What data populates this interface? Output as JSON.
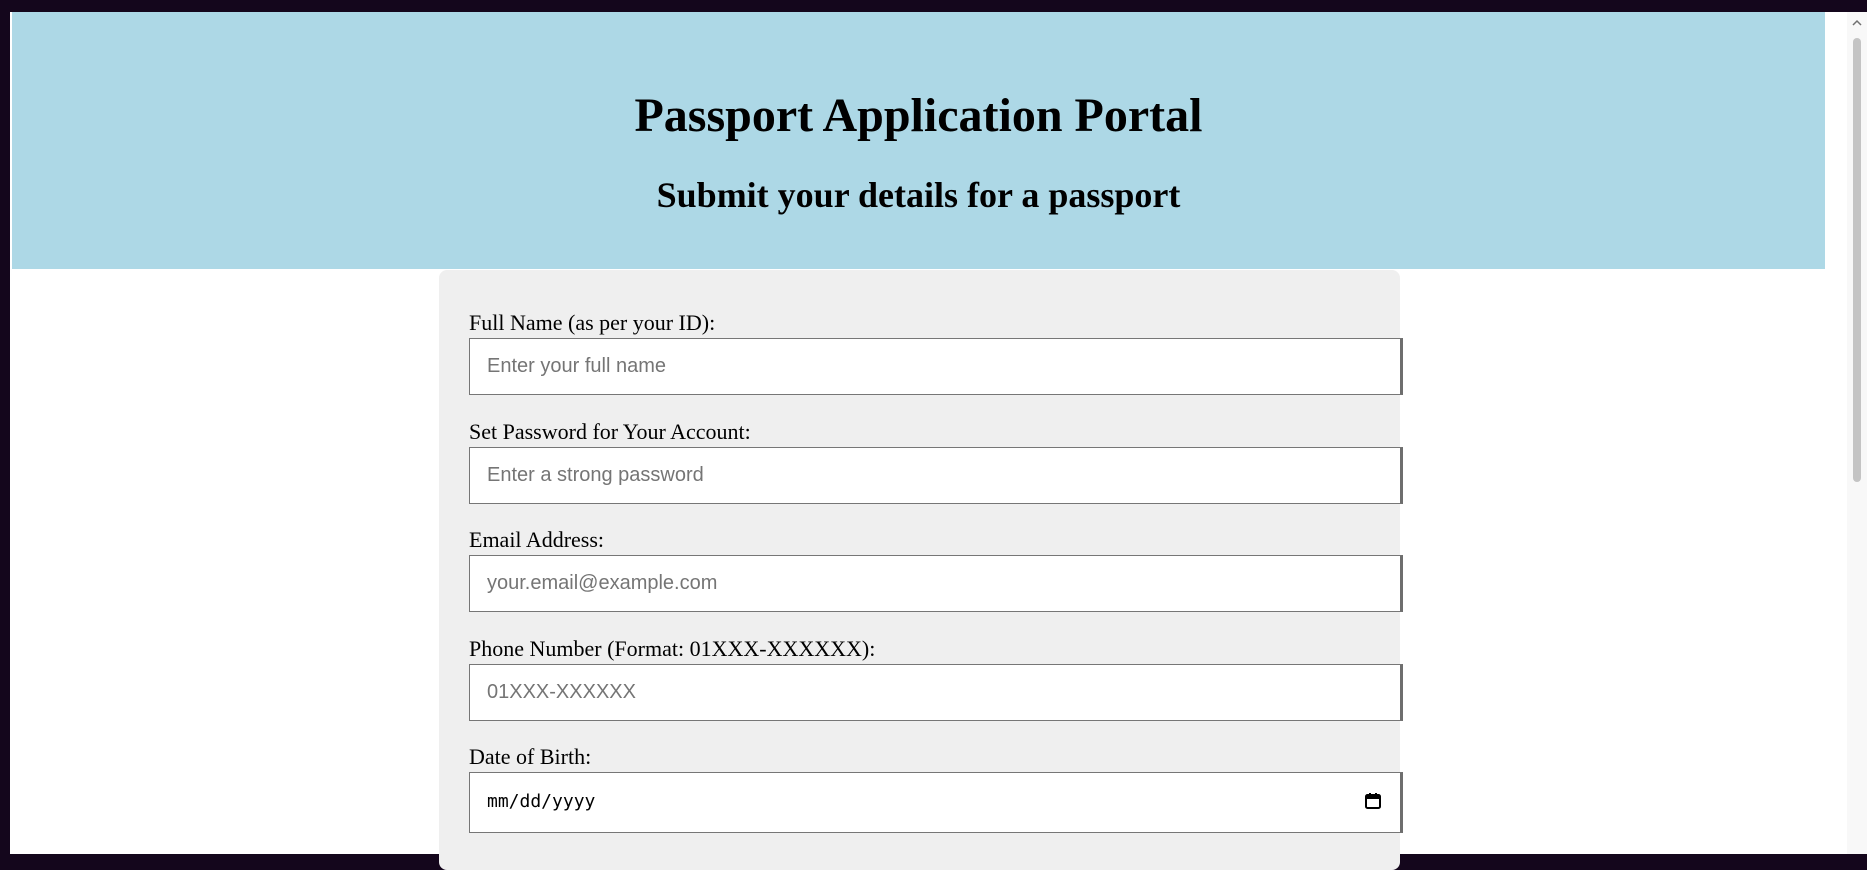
{
  "header": {
    "title": "Passport Application Portal",
    "subtitle": "Submit your details for a passport"
  },
  "form": {
    "full_name": {
      "label": "Full Name (as per your ID):",
      "placeholder": "Enter your full name"
    },
    "password": {
      "label": "Set Password for Your Account:",
      "placeholder": "Enter a strong password"
    },
    "email": {
      "label": "Email Address:",
      "placeholder": "your.email@example.com"
    },
    "phone": {
      "label": "Phone Number (Format: 01XXX-XXXXXX):",
      "placeholder": "01XXX-XXXXXX"
    },
    "dob": {
      "label": "Date of Birth:",
      "placeholder": "mm/dd/yyyy"
    }
  },
  "colors": {
    "header_bg": "#add8e6",
    "form_bg": "#efefef",
    "page_bg": "#ffffff",
    "outer_bg": "#14061c"
  },
  "icons": {
    "calendar": "calendar-icon",
    "scroll_up": "chevron-up-icon"
  }
}
